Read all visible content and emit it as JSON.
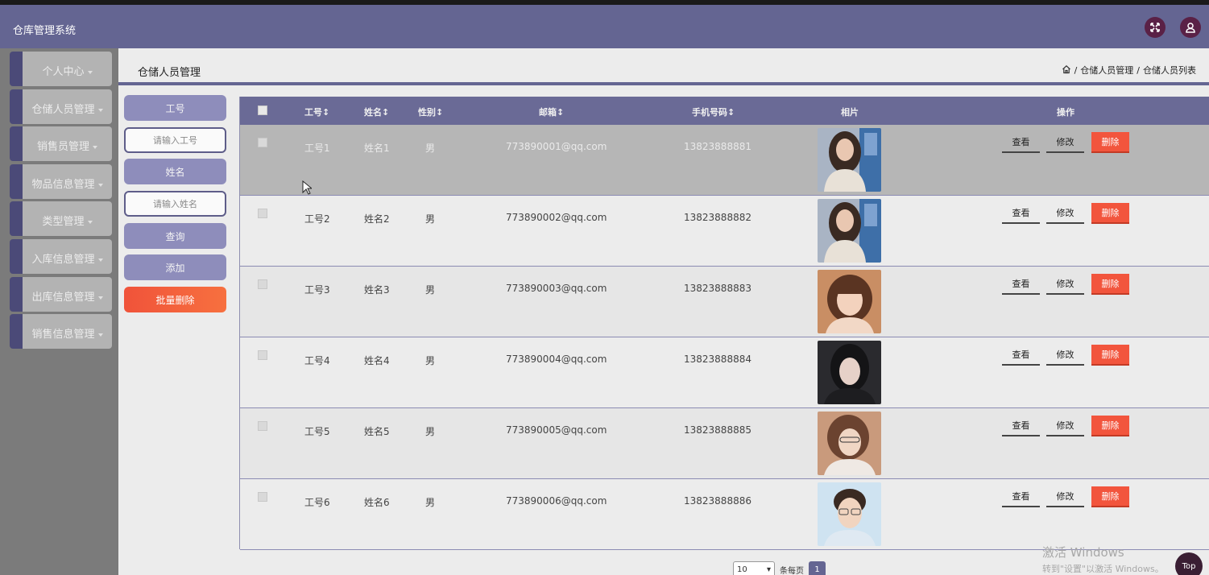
{
  "app": {
    "title": "仓库管理系统"
  },
  "sidebar": {
    "items": [
      {
        "label": "个人中心"
      },
      {
        "label": "仓储人员管理"
      },
      {
        "label": "销售员管理"
      },
      {
        "label": "物品信息管理"
      },
      {
        "label": "类型管理"
      },
      {
        "label": "入库信息管理"
      },
      {
        "label": "出库信息管理"
      },
      {
        "label": "销售信息管理"
      }
    ]
  },
  "header": {
    "title": "仓储人员管理",
    "breadcrumb": [
      "仓储人员管理",
      "仓储人员列表"
    ],
    "separator": "/"
  },
  "search": {
    "id_label": "工号",
    "id_placeholder": "请输入工号",
    "name_label": "姓名",
    "name_placeholder": "请输入姓名",
    "query_button": "查询",
    "add_button": "添加",
    "batch_delete_button": "批量删除"
  },
  "table": {
    "columns": [
      "工号",
      "姓名",
      "性别",
      "邮箱",
      "手机号码",
      "相片",
      "操作"
    ],
    "rows": [
      {
        "id": "工号1",
        "name": "姓名1",
        "gender": "男",
        "email": "773890001@qq.com",
        "phone": "13823888881"
      },
      {
        "id": "工号2",
        "name": "姓名2",
        "gender": "男",
        "email": "773890002@qq.com",
        "phone": "13823888882"
      },
      {
        "id": "工号3",
        "name": "姓名3",
        "gender": "男",
        "email": "773890003@qq.com",
        "phone": "13823888883"
      },
      {
        "id": "工号4",
        "name": "姓名4",
        "gender": "男",
        "email": "773890004@qq.com",
        "phone": "13823888884"
      },
      {
        "id": "工号5",
        "name": "姓名5",
        "gender": "男",
        "email": "773890005@qq.com",
        "phone": "13823888885"
      },
      {
        "id": "工号6",
        "name": "姓名6",
        "gender": "男",
        "email": "773890006@qq.com",
        "phone": "13823888886"
      }
    ],
    "actions": {
      "view": "查看",
      "edit": "修改",
      "delete": "删除"
    }
  },
  "pagination": {
    "page_size": "10",
    "per_page_label": "条每页",
    "current_page": "1"
  },
  "watermark": {
    "line1": "激活 Windows",
    "line2": "转到\"设置\"以激活 Windows。"
  },
  "back_to_top": "Top",
  "colors": {
    "primary": "#646592",
    "danger": "#f2553d",
    "sidebar_bg": "#7b7b7b"
  }
}
